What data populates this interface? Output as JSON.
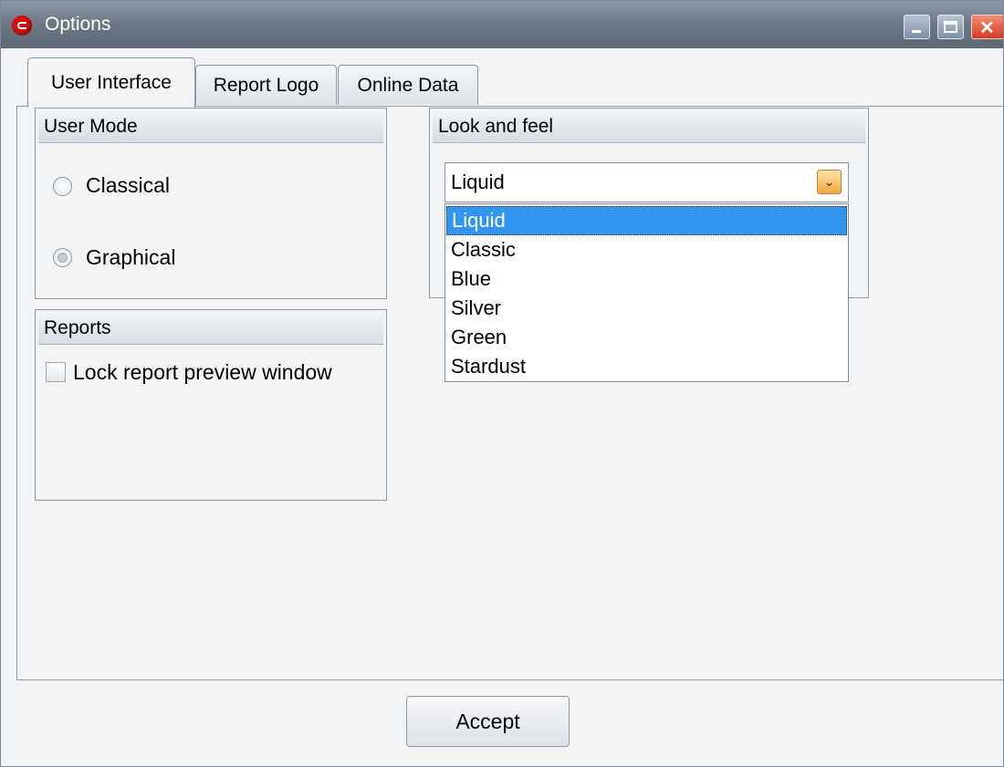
{
  "window": {
    "title": "Options",
    "app_icon": "app-logo-icon"
  },
  "titlebar_buttons": [
    "minimize-icon",
    "maximize-icon",
    "close-icon"
  ],
  "tabs": [
    {
      "label": "User Interface",
      "active": true
    },
    {
      "label": "Report Logo",
      "active": false
    },
    {
      "label": "Online Data",
      "active": false
    }
  ],
  "user_mode": {
    "title": "User Mode",
    "options": [
      {
        "label": "Classical",
        "checked": false
      },
      {
        "label": "Graphical",
        "checked": true
      }
    ]
  },
  "reports": {
    "title": "Reports",
    "lock_preview": {
      "label": "Lock report preview window",
      "checked": false
    }
  },
  "look_and_feel": {
    "title": "Look and feel",
    "selected": "Liquid",
    "options": [
      "Liquid",
      "Classic",
      "Blue",
      "Silver",
      "Green",
      "Stardust"
    ],
    "highlighted_index": 0,
    "dropdown_open": true
  },
  "footer": {
    "accept_label": "Accept"
  },
  "colors": {
    "selection": "#3296f0",
    "title_bar": "#6d7784",
    "close_button": "#d43b23",
    "combo_arrow": "#f2a844"
  }
}
